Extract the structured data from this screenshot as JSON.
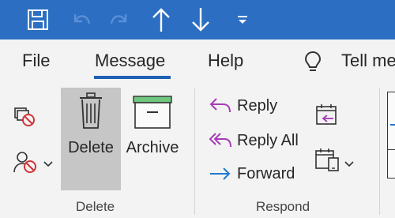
{
  "qat": {
    "buttons": [
      {
        "name": "save-icon"
      },
      {
        "name": "undo-icon"
      },
      {
        "name": "redo-icon"
      },
      {
        "name": "up-arrow-icon"
      },
      {
        "name": "down-arrow-icon"
      },
      {
        "name": "customize-toolbar-icon"
      }
    ]
  },
  "tabs": [
    {
      "label": "File",
      "active": false
    },
    {
      "label": "Message",
      "active": true
    },
    {
      "label": "Help",
      "active": false
    }
  ],
  "tell_me": {
    "label": "Tell me"
  },
  "ribbon": {
    "delete_group": {
      "label": "Delete",
      "buttons": {
        "delete": "Delete",
        "archive": "Archive"
      }
    },
    "respond_group": {
      "label": "Respond",
      "buttons": {
        "reply": "Reply",
        "reply_all": "Reply All",
        "forward": "Forward"
      }
    }
  },
  "colors": {
    "title_bar": "#2b6ec2",
    "tab_underline": "#1f5fb3",
    "reply_purple": "#a53cb6",
    "forward_blue": "#1f7bd0",
    "archive_green": "#6ec77c",
    "delete_red": "#d13438",
    "selected_button": "#c6c6c6"
  }
}
